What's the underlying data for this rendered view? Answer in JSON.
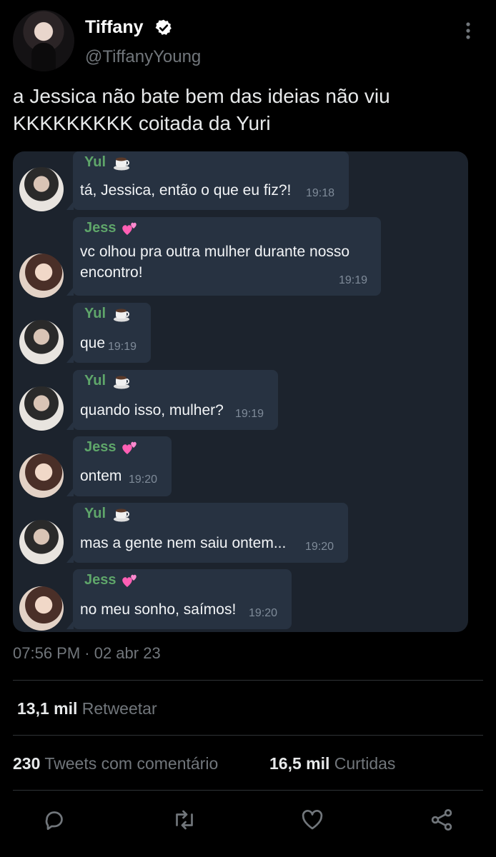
{
  "author": {
    "name": "Tiffany",
    "handle": "@TiffanyYoung"
  },
  "tweet": {
    "text_line1": "a Jessica não bate bem das ideias não viu",
    "text_line2": "KKKKKKKKK coitada da Yuri",
    "timestamp": "07:56 PM · 02 abr 23"
  },
  "chat": [
    {
      "sender": "Yul",
      "emoji": "coffee-emoji",
      "lines": [
        "tá, Jessica, então o que eu fiz?!"
      ],
      "time": "19:18"
    },
    {
      "sender": "Jess",
      "emoji": "hearts-emoji",
      "lines": [
        "vc olhou pra outra mulher durante nosso",
        "encontro!"
      ],
      "time": "19:19"
    },
    {
      "sender": "Yul",
      "emoji": "coffee-emoji",
      "lines": [
        "que"
      ],
      "time": "19:19"
    },
    {
      "sender": "Yul",
      "emoji": "coffee-emoji",
      "lines": [
        "quando isso, mulher?"
      ],
      "time": "19:19"
    },
    {
      "sender": "Jess",
      "emoji": "hearts-emoji",
      "lines": [
        "ontem"
      ],
      "time": "19:20"
    },
    {
      "sender": "Yul",
      "emoji": "coffee-emoji",
      "lines": [
        "mas a gente nem saiu ontem..."
      ],
      "time": "19:20"
    },
    {
      "sender": "Jess",
      "emoji": "hearts-emoji",
      "lines": [
        "no meu sonho, saímos!"
      ],
      "time": "19:20"
    }
  ],
  "stats": {
    "retweets_count": "13,1 mil",
    "retweets_label": "Retweetar",
    "quotes_count": "230",
    "quotes_label": "Tweets com comentário",
    "likes_count": "16,5 mil",
    "likes_label": "Curtidas"
  },
  "colors": {
    "background": "#000000",
    "text": "#e7e9ea",
    "muted": "#71767b",
    "chat_bg": "#1c232d",
    "bubble": "#273241",
    "sender": "#5fa66a",
    "verified": "#ffffff"
  },
  "icons": [
    "verified-icon",
    "more-icon",
    "reply-icon",
    "retweet-icon",
    "like-icon",
    "share-icon"
  ]
}
